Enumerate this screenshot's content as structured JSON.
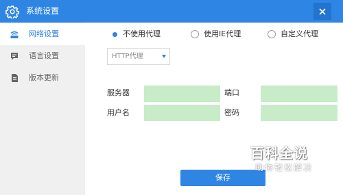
{
  "window": {
    "title": "系统设置",
    "title_icon": "gear-icon",
    "close_icon": "close-icon",
    "accent_color": "#2f85e4"
  },
  "sidebar": {
    "items": [
      {
        "label": "网络设置",
        "icon": "network-icon",
        "active": true
      },
      {
        "label": "语言设置",
        "icon": "chat-icon",
        "active": false
      },
      {
        "label": "版本更新",
        "icon": "document-icon",
        "active": false
      }
    ]
  },
  "proxy": {
    "options": [
      {
        "label": "不使用代理",
        "selected": true
      },
      {
        "label": "使用IE代理",
        "selected": false
      },
      {
        "label": "自定义代理",
        "selected": false
      }
    ],
    "type_select": {
      "value": "HTTP代理"
    }
  },
  "fields": {
    "server": {
      "label": "服务器",
      "value": ""
    },
    "port": {
      "label": "端口",
      "value": ""
    },
    "username": {
      "label": "用户名",
      "value": ""
    },
    "password": {
      "label": "密码",
      "value": ""
    },
    "input_color": "#c8ecc8"
  },
  "actions": {
    "save_label": "保存"
  },
  "watermark": {
    "main": "百科全说",
    "sub": "助你轻松解决"
  }
}
